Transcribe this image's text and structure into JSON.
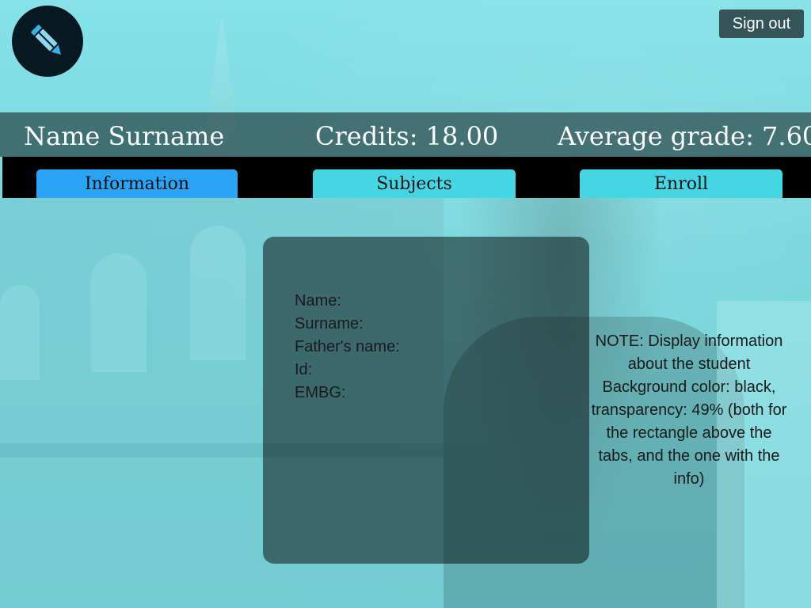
{
  "header": {
    "sign_out_label": "Sign out",
    "student_name": "Name Surname",
    "credits_text": "Credits: 18.00",
    "average_text": "Average grade: 7.60"
  },
  "tabs": [
    {
      "label": "Information",
      "active": true
    },
    {
      "label": "Subjects",
      "active": false
    },
    {
      "label": "Enroll",
      "active": false
    }
  ],
  "info_fields": [
    "Name:",
    "Surname:",
    "Father's name:",
    "Id:",
    "EMBG:"
  ],
  "note": "NOTE: Display information about the student Background color: black, transparency: 49% (both for the rectangle above the tabs, and the one with the info)",
  "icons": {
    "logo": "pencil-icon"
  },
  "colors": {
    "active_tab": "#2aa4f4",
    "inactive_tab": "#44d7e3",
    "background": "#7fdde3",
    "overlay": "rgba(0,0,0,0.49)"
  }
}
